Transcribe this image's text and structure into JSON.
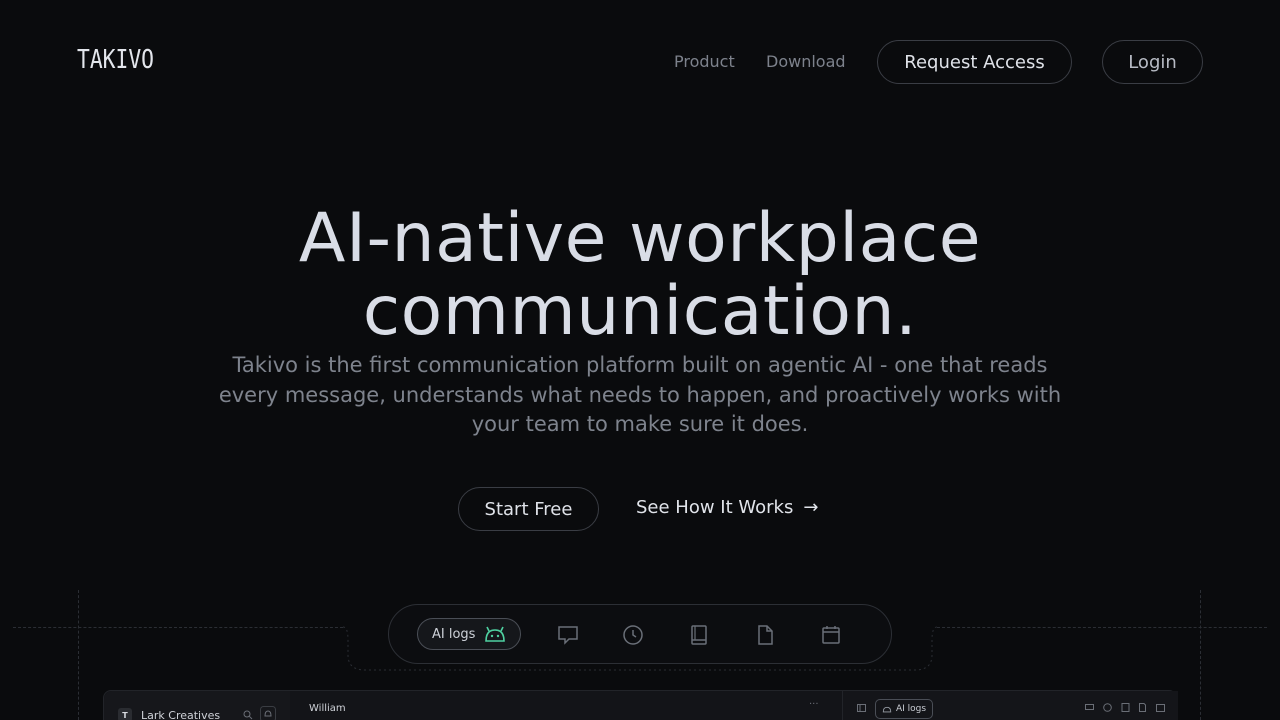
{
  "brand": {
    "logo_text": "TAKIVO"
  },
  "nav": {
    "product": "Product",
    "download": "Download",
    "request_access": "Request Access",
    "login": "Login"
  },
  "hero": {
    "title_line1": "AI-native workplace",
    "title_line2": "communication.",
    "subtitle": "Takivo is the first communication platform built on agentic AI - one that reads every message, understands what needs to happen, and proactively works with your team to make sure it does.",
    "cta_primary": "Start Free",
    "cta_secondary": "See How It Works",
    "cta_secondary_arrow": "→"
  },
  "toolbar": {
    "active_tab_label": "AI logs",
    "icons": [
      "robot-icon",
      "chat-icon",
      "clock-icon",
      "book-icon",
      "document-icon",
      "calendar-icon"
    ]
  },
  "app_preview": {
    "workspace_initial": "T",
    "workspace_name": "Lark Creatives",
    "chat_title": "William",
    "more": "···",
    "panel_tab": "AI logs"
  },
  "colors": {
    "background": "#0a0b0d",
    "accent_green": "#4fd1a1"
  }
}
